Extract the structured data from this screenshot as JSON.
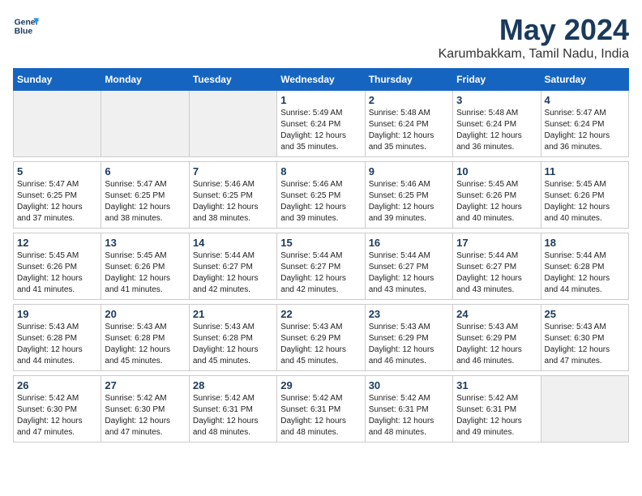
{
  "header": {
    "logo_line1": "General",
    "logo_line2": "Blue",
    "title": "May 2024",
    "subtitle": "Karumbakkam, Tamil Nadu, India"
  },
  "calendar": {
    "days_of_week": [
      "Sunday",
      "Monday",
      "Tuesday",
      "Wednesday",
      "Thursday",
      "Friday",
      "Saturday"
    ],
    "weeks": [
      [
        {
          "num": "",
          "detail": ""
        },
        {
          "num": "",
          "detail": ""
        },
        {
          "num": "",
          "detail": ""
        },
        {
          "num": "1",
          "detail": "Sunrise: 5:49 AM\nSunset: 6:24 PM\nDaylight: 12 hours\nand 35 minutes."
        },
        {
          "num": "2",
          "detail": "Sunrise: 5:48 AM\nSunset: 6:24 PM\nDaylight: 12 hours\nand 35 minutes."
        },
        {
          "num": "3",
          "detail": "Sunrise: 5:48 AM\nSunset: 6:24 PM\nDaylight: 12 hours\nand 36 minutes."
        },
        {
          "num": "4",
          "detail": "Sunrise: 5:47 AM\nSunset: 6:24 PM\nDaylight: 12 hours\nand 36 minutes."
        }
      ],
      [
        {
          "num": "5",
          "detail": "Sunrise: 5:47 AM\nSunset: 6:25 PM\nDaylight: 12 hours\nand 37 minutes."
        },
        {
          "num": "6",
          "detail": "Sunrise: 5:47 AM\nSunset: 6:25 PM\nDaylight: 12 hours\nand 38 minutes."
        },
        {
          "num": "7",
          "detail": "Sunrise: 5:46 AM\nSunset: 6:25 PM\nDaylight: 12 hours\nand 38 minutes."
        },
        {
          "num": "8",
          "detail": "Sunrise: 5:46 AM\nSunset: 6:25 PM\nDaylight: 12 hours\nand 39 minutes."
        },
        {
          "num": "9",
          "detail": "Sunrise: 5:46 AM\nSunset: 6:25 PM\nDaylight: 12 hours\nand 39 minutes."
        },
        {
          "num": "10",
          "detail": "Sunrise: 5:45 AM\nSunset: 6:26 PM\nDaylight: 12 hours\nand 40 minutes."
        },
        {
          "num": "11",
          "detail": "Sunrise: 5:45 AM\nSunset: 6:26 PM\nDaylight: 12 hours\nand 40 minutes."
        }
      ],
      [
        {
          "num": "12",
          "detail": "Sunrise: 5:45 AM\nSunset: 6:26 PM\nDaylight: 12 hours\nand 41 minutes."
        },
        {
          "num": "13",
          "detail": "Sunrise: 5:45 AM\nSunset: 6:26 PM\nDaylight: 12 hours\nand 41 minutes."
        },
        {
          "num": "14",
          "detail": "Sunrise: 5:44 AM\nSunset: 6:27 PM\nDaylight: 12 hours\nand 42 minutes."
        },
        {
          "num": "15",
          "detail": "Sunrise: 5:44 AM\nSunset: 6:27 PM\nDaylight: 12 hours\nand 42 minutes."
        },
        {
          "num": "16",
          "detail": "Sunrise: 5:44 AM\nSunset: 6:27 PM\nDaylight: 12 hours\nand 43 minutes."
        },
        {
          "num": "17",
          "detail": "Sunrise: 5:44 AM\nSunset: 6:27 PM\nDaylight: 12 hours\nand 43 minutes."
        },
        {
          "num": "18",
          "detail": "Sunrise: 5:44 AM\nSunset: 6:28 PM\nDaylight: 12 hours\nand 44 minutes."
        }
      ],
      [
        {
          "num": "19",
          "detail": "Sunrise: 5:43 AM\nSunset: 6:28 PM\nDaylight: 12 hours\nand 44 minutes."
        },
        {
          "num": "20",
          "detail": "Sunrise: 5:43 AM\nSunset: 6:28 PM\nDaylight: 12 hours\nand 45 minutes."
        },
        {
          "num": "21",
          "detail": "Sunrise: 5:43 AM\nSunset: 6:28 PM\nDaylight: 12 hours\nand 45 minutes."
        },
        {
          "num": "22",
          "detail": "Sunrise: 5:43 AM\nSunset: 6:29 PM\nDaylight: 12 hours\nand 45 minutes."
        },
        {
          "num": "23",
          "detail": "Sunrise: 5:43 AM\nSunset: 6:29 PM\nDaylight: 12 hours\nand 46 minutes."
        },
        {
          "num": "24",
          "detail": "Sunrise: 5:43 AM\nSunset: 6:29 PM\nDaylight: 12 hours\nand 46 minutes."
        },
        {
          "num": "25",
          "detail": "Sunrise: 5:43 AM\nSunset: 6:30 PM\nDaylight: 12 hours\nand 47 minutes."
        }
      ],
      [
        {
          "num": "26",
          "detail": "Sunrise: 5:42 AM\nSunset: 6:30 PM\nDaylight: 12 hours\nand 47 minutes."
        },
        {
          "num": "27",
          "detail": "Sunrise: 5:42 AM\nSunset: 6:30 PM\nDaylight: 12 hours\nand 47 minutes."
        },
        {
          "num": "28",
          "detail": "Sunrise: 5:42 AM\nSunset: 6:31 PM\nDaylight: 12 hours\nand 48 minutes."
        },
        {
          "num": "29",
          "detail": "Sunrise: 5:42 AM\nSunset: 6:31 PM\nDaylight: 12 hours\nand 48 minutes."
        },
        {
          "num": "30",
          "detail": "Sunrise: 5:42 AM\nSunset: 6:31 PM\nDaylight: 12 hours\nand 48 minutes."
        },
        {
          "num": "31",
          "detail": "Sunrise: 5:42 AM\nSunset: 6:31 PM\nDaylight: 12 hours\nand 49 minutes."
        },
        {
          "num": "",
          "detail": ""
        }
      ]
    ]
  }
}
